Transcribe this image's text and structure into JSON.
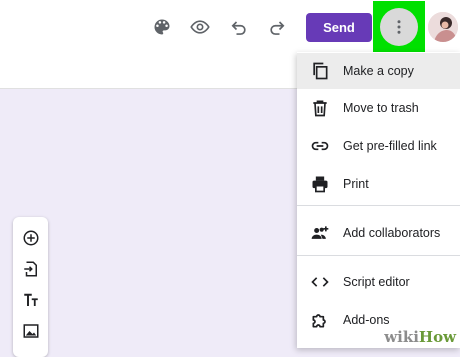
{
  "toolbar": {
    "palette_icon": "palette-icon",
    "preview_icon": "eye-icon",
    "undo_icon": "undo-icon",
    "redo_icon": "redo-icon",
    "send_label": "Send",
    "more_icon": "more-vert-icon",
    "highlight_color": "#00e000",
    "send_color": "#673ab7"
  },
  "menu": {
    "items": [
      {
        "label": "Make a copy",
        "icon": "copy-icon"
      },
      {
        "label": "Move to trash",
        "icon": "trash-icon"
      },
      {
        "label": "Get pre-filled link",
        "icon": "link-icon"
      },
      {
        "label": "Print",
        "icon": "print-icon"
      },
      {
        "label": "Add collaborators",
        "icon": "add-collaborators-icon"
      },
      {
        "label": "Script editor",
        "icon": "code-icon"
      },
      {
        "label": "Add-ons",
        "icon": "puzzle-icon"
      }
    ]
  },
  "side_tools": [
    {
      "icon": "add-circle-icon"
    },
    {
      "icon": "import-icon"
    },
    {
      "icon": "title-text-icon"
    },
    {
      "icon": "image-icon"
    }
  ],
  "watermark": {
    "wiki": "wiki",
    "how": "How"
  },
  "colors": {
    "background": "#efebf8",
    "accent": "#673ab7"
  }
}
